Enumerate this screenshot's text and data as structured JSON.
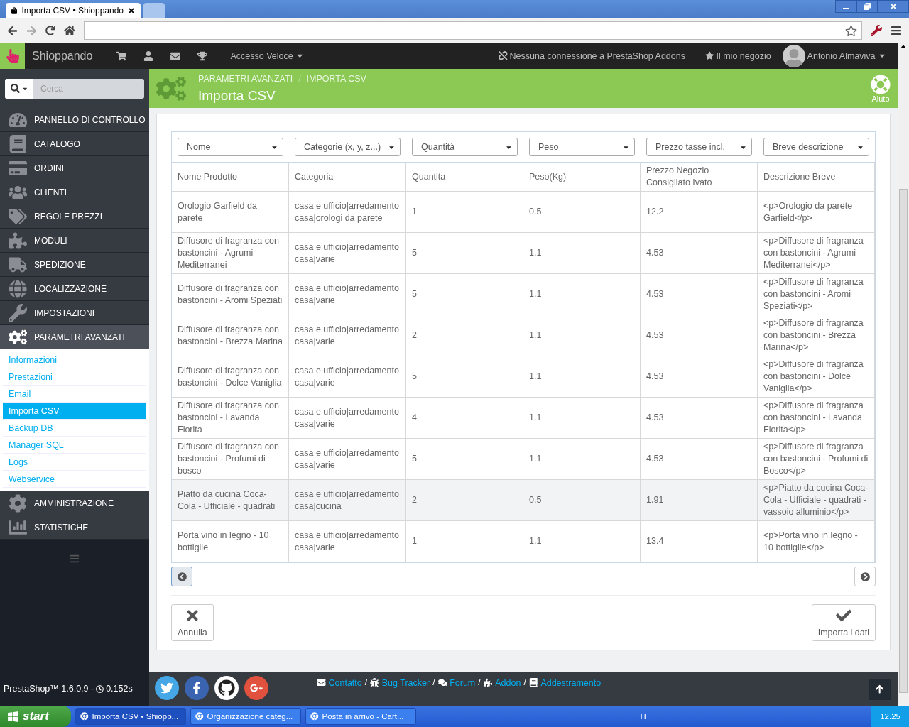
{
  "browser": {
    "tabs": [
      {
        "title": "Importa CSV • Shioppando",
        "selected": true
      },
      {
        "selected": false
      }
    ]
  },
  "header": {
    "shop_name": "Shioppando",
    "quick_access": "Accesso Veloce",
    "addons_status": "Nessuna connessione a PrestaShop Addons",
    "my_shop": "Il mio negozio",
    "user_name": "Antonio Almaviva"
  },
  "search": {
    "placeholder": "Cerca"
  },
  "sidebar": {
    "items": [
      {
        "label": "PANNELLO DI CONTROLLO",
        "expanded": false
      },
      {
        "label": "CATALOGO",
        "expanded": false
      },
      {
        "label": "ORDINI",
        "expanded": false
      },
      {
        "label": "CLIENTI",
        "expanded": false
      },
      {
        "label": "REGOLE PREZZI",
        "expanded": false
      },
      {
        "label": "MODULI",
        "expanded": false
      },
      {
        "label": "SPEDIZIONE",
        "expanded": false
      },
      {
        "label": "LOCALIZZAZIONE",
        "expanded": false
      },
      {
        "label": "IMPOSTAZIONI",
        "expanded": false
      },
      {
        "label": "PARAMETRI AVANZATI",
        "expanded": true,
        "children": [
          {
            "label": "Informazioni",
            "selected": false
          },
          {
            "label": "Prestazioni",
            "selected": false
          },
          {
            "label": "Email",
            "selected": false
          },
          {
            "label": "Importa CSV",
            "selected": true
          },
          {
            "label": "Backup DB",
            "selected": false
          },
          {
            "label": "Manager SQL",
            "selected": false
          },
          {
            "label": "Logs",
            "selected": false
          },
          {
            "label": "Webservice",
            "selected": false
          }
        ]
      },
      {
        "label": "AMMINISTRAZIONE",
        "expanded": false
      },
      {
        "label": "STATISTICHE",
        "expanded": false
      }
    ]
  },
  "page": {
    "breadcrumb": [
      {
        "label": "PARAMETRI AVANZATI",
        "separator": "/"
      },
      {
        "label": "IMPORTA CSV"
      }
    ],
    "title": "Importa CSV",
    "help_label": "Aiuto"
  },
  "table": {
    "selects": [
      "Nome",
      "Categorie (x, y, z...)",
      "Quantità",
      "Peso",
      "Prezzo tasse incl.",
      "Breve descrizione"
    ],
    "columns": [
      "Nome Prodotto",
      "Categoria",
      "Quantita",
      "Peso(Kg)",
      "Prezzo Negozio Consigliato Ivato",
      "Descrizione Breve"
    ],
    "rows": [
      {
        "selected": false,
        "cells": [
          "Orologio Garfield da parete",
          "casa e ufficio|arredamento casa|orologi da parete",
          "1",
          "0.5",
          "12.2",
          "<p>Orologio da parete Garfield</p>"
        ]
      },
      {
        "selected": false,
        "cells": [
          "Diffusore di fragranza con bastoncini - Agrumi Mediterranei",
          "casa e ufficio|arredamento casa|varie",
          "5",
          "1.1",
          "4.53",
          "<p>Diffusore di fragranza con bastoncini - Agrumi Mediterranei</p>"
        ]
      },
      {
        "selected": false,
        "cells": [
          "Diffusore di fragranza con bastoncini - Aromi Speziati",
          "casa e ufficio|arredamento casa|varie",
          "5",
          "1.1",
          "4.53",
          "<p>Diffusore di fragranza con bastoncini - Aromi Speziati</p>"
        ]
      },
      {
        "selected": false,
        "cells": [
          "Diffusore di fragranza con bastoncini - Brezza Marina",
          "casa e ufficio|arredamento casa|varie",
          "2",
          "1.1",
          "4.53",
          "<p>Diffusore di fragranza con bastoncini - Brezza Marina</p>"
        ]
      },
      {
        "selected": false,
        "cells": [
          "Diffusore di fragranza con bastoncini - Dolce Vaniglia",
          "casa e ufficio|arredamento casa|varie",
          "5",
          "1.1",
          "4.53",
          "<p>Diffusore di fragranza con bastoncini - Dolce Vaniglia</p>"
        ]
      },
      {
        "selected": false,
        "cells": [
          "Diffusore di fragranza con bastoncini - Lavanda Fiorita",
          "casa e ufficio|arredamento casa|varie",
          "4",
          "1.1",
          "4.53",
          "<p>Diffusore di fragranza con bastoncini - Lavanda Fiorita</p>"
        ]
      },
      {
        "selected": false,
        "cells": [
          "Diffusore di fragranza con bastoncini - Profumi di bosco",
          "casa e ufficio|arredamento casa|varie",
          "5",
          "1.1",
          "4.53",
          "<p>Diffusore di fragranza con bastoncini - Profumi di Bosco</p>"
        ]
      },
      {
        "selected": true,
        "cells": [
          "Piatto da cucina Coca-Cola - Ufficiale - quadrati",
          "casa e ufficio|arredamento casa|cucina",
          "2",
          "0.5",
          "1.91",
          "<p>Piatto da cucina Coca-Cola - Ufficiale - quadrati - vassoio alluminio</p>"
        ]
      },
      {
        "selected": false,
        "cells": [
          "Porta vino in legno - 10 bottiglie",
          "casa e ufficio|arredamento casa|varie",
          "1",
          "1.1",
          "13.4",
          "<p>Porta vino in legno - 10 bottiglie</p>"
        ]
      }
    ]
  },
  "actions": {
    "cancel": "Annulla",
    "import": "Importa i dati"
  },
  "footer": {
    "version": "PrestaShop™ 1.6.0.9 -",
    "load_time": "0.152s",
    "links": [
      {
        "label": "Contatto",
        "separator": "/"
      },
      {
        "label": "Bug Tracker",
        "separator": "/"
      },
      {
        "label": "Forum",
        "separator": "/"
      },
      {
        "label": "Addon",
        "separator": "/"
      },
      {
        "label": "Addestramento"
      }
    ]
  },
  "taskbar": {
    "start": "start",
    "items": [
      {
        "label": "Importa CSV • Shiopp...",
        "selected": true
      },
      {
        "label": "Organizzazione categ...",
        "selected": false
      },
      {
        "label": "Posta in arrivo - Cart...",
        "selected": false
      }
    ],
    "language": "IT",
    "clock": "12.25"
  }
}
